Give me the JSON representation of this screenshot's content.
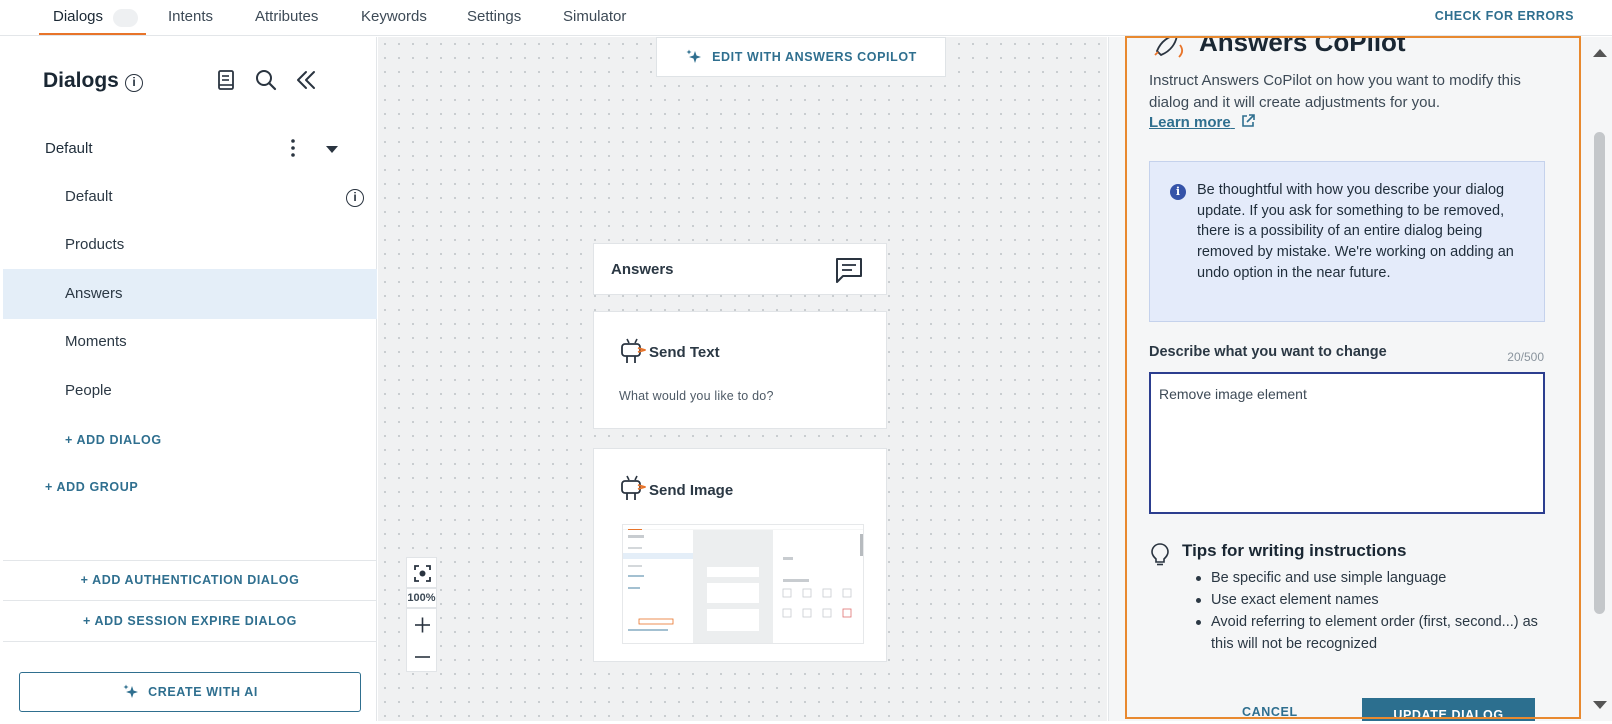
{
  "nav": {
    "tabs": [
      {
        "label": "Dialogs",
        "active": true
      },
      {
        "label": "Intents",
        "active": false
      },
      {
        "label": "Attributes",
        "active": false
      },
      {
        "label": "Keywords",
        "active": false
      },
      {
        "label": "Settings",
        "active": false
      },
      {
        "label": "Simulator",
        "active": false
      }
    ],
    "check_errors": "CHECK FOR ERRORS"
  },
  "sidebar": {
    "title": "Dialogs",
    "info_icon": "i",
    "icons": [
      "book-icon",
      "search-icon",
      "collapse-icon"
    ],
    "group": {
      "label": "Default"
    },
    "items": [
      {
        "label": "Default",
        "selected": false,
        "info": true
      },
      {
        "label": "Products",
        "selected": false
      },
      {
        "label": "Answers",
        "selected": true
      },
      {
        "label": "Moments",
        "selected": false
      },
      {
        "label": "People",
        "selected": false
      }
    ],
    "add_dialog": "+ ADD DIALOG",
    "add_group": "+ ADD GROUP",
    "add_auth_dialog": "+ ADD AUTHENTICATION DIALOG",
    "add_session_expire": "+ ADD SESSION EXPIRE DIALOG",
    "create_ai": "CREATE WITH AI"
  },
  "canvas": {
    "edit_copilot": "EDIT WITH ANSWERS COPILOT",
    "start_node": {
      "title": "Answers"
    },
    "send_text": {
      "title": "Send Text",
      "text": "What would you like to do?"
    },
    "send_image": {
      "title": "Send Image"
    },
    "zoom": "100%"
  },
  "copilot": {
    "title": "Answers CoPilot",
    "description": "Instruct Answers CoPilot on how you want to modify this dialog and it will create adjustments for you.",
    "learn_more": "Learn more",
    "notice": "Be thoughtful with how you describe your dialog update. If you ask for something to be removed, there is a possibility of an entire dialog being removed by mistake. We're working on adding an undo option in the near future.",
    "field_label": "Describe what you want to change",
    "char_count": "20/500",
    "input_value": "Remove image element",
    "tips_title": "Tips for writing instructions",
    "tips": [
      "Be specific and use simple language",
      "Use exact element names",
      "Avoid referring to element order (first, second...) as this will not be recognized"
    ],
    "cancel": "CANCEL",
    "update": "UPDATE DIALOG"
  },
  "colors": {
    "accent": "#2f6f8f",
    "highlight": "#e8892f",
    "selected": "#e4eef8"
  }
}
